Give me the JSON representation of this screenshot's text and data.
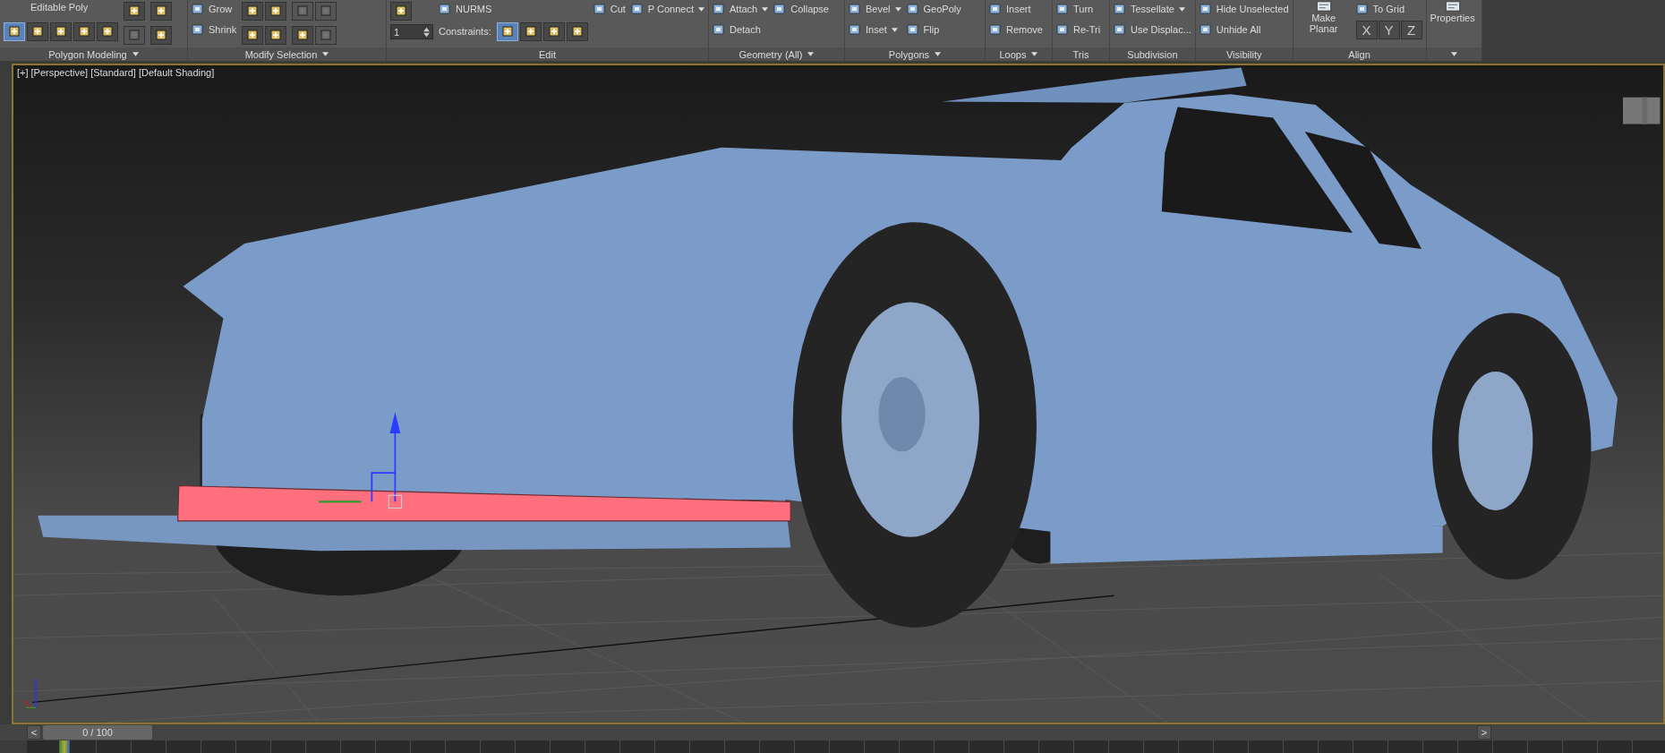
{
  "ribbon": {
    "panels": [
      {
        "title": "Polygon Modeling",
        "columns": [
          [
            {
              "kind": "label",
              "label": "Editable Poly"
            },
            {
              "kind": "icon-row",
              "buttons": [
                {
                  "selected": true,
                  "disabled": false
                },
                {
                  "selected": false,
                  "disabled": false
                },
                {
                  "selected": false,
                  "disabled": false
                },
                {
                  "selected": false,
                  "disabled": false
                },
                {
                  "selected": false,
                  "disabled": false
                }
              ]
            }
          ],
          [
            {
              "kind": "icon-row",
              "buttons": [
                {
                  "selected": false,
                  "disabled": false
                }
              ]
            },
            {
              "kind": "icon-row",
              "buttons": [
                {
                  "selected": false,
                  "disabled": true
                }
              ]
            }
          ],
          [
            {
              "kind": "icon-row",
              "buttons": [
                {
                  "selected": false,
                  "disabled": false
                }
              ]
            },
            {
              "kind": "icon-row",
              "buttons": [
                {
                  "selected": false,
                  "disabled": false
                }
              ]
            }
          ]
        ]
      },
      {
        "title": "Modify Selection",
        "columns": [
          [
            {
              "kind": "button",
              "label": "Grow",
              "dropdown": false
            },
            {
              "kind": "button",
              "label": "Shrink",
              "dropdown": false
            }
          ],
          [
            {
              "kind": "icon-row",
              "buttons": [
                {
                  "selected": false,
                  "disabled": false
                },
                {
                  "selected": false,
                  "disabled": false
                }
              ]
            },
            {
              "kind": "icon-row",
              "buttons": [
                {
                  "selected": false,
                  "disabled": false
                },
                {
                  "selected": false,
                  "disabled": false
                }
              ]
            }
          ],
          [
            {
              "kind": "icon-row",
              "buttons": [
                {
                  "selected": false,
                  "disabled": true
                },
                {
                  "selected": false,
                  "disabled": true
                }
              ]
            },
            {
              "kind": "icon-row",
              "buttons": [
                {
                  "selected": false,
                  "disabled": false
                },
                {
                  "selected": false,
                  "disabled": true
                }
              ]
            }
          ]
        ]
      },
      {
        "title": "Edit",
        "columns": [
          [
            {
              "kind": "icon-row",
              "buttons": [
                {
                  "selected": false,
                  "disabled": false
                }
              ]
            },
            {
              "kind": "spinner",
              "value": "1"
            }
          ],
          [
            {
              "kind": "button",
              "label": "NURMS",
              "dropdown": false
            },
            {
              "kind": "icon-row",
              "label": "Constraints:",
              "buttons": [
                {
                  "selected": true,
                  "disabled": false
                },
                {
                  "selected": false,
                  "disabled": false
                },
                {
                  "selected": false,
                  "disabled": false
                },
                {
                  "selected": false,
                  "disabled": false
                }
              ]
            }
          ],
          [
            {
              "kind": "button",
              "label": "Cut",
              "dropdown": false
            }
          ],
          [
            {
              "kind": "button",
              "label": "P Connect",
              "dropdown": true
            }
          ]
        ]
      },
      {
        "title": "Geometry (All)",
        "columns": [
          [
            {
              "kind": "button",
              "label": "Attach",
              "dropdown": true
            },
            {
              "kind": "button",
              "label": "Detach",
              "dropdown": false
            }
          ],
          [
            {
              "kind": "button",
              "label": "Collapse",
              "dropdown": false
            }
          ]
        ]
      },
      {
        "title": "Polygons",
        "columns": [
          [
            {
              "kind": "button",
              "label": "Bevel",
              "dropdown": true
            },
            {
              "kind": "button",
              "label": "Inset",
              "dropdown": true
            }
          ],
          [
            {
              "kind": "button",
              "label": "GeoPoly",
              "dropdown": false
            },
            {
              "kind": "button",
              "label": "Flip",
              "dropdown": false
            }
          ]
        ]
      },
      {
        "title": "Loops",
        "columns": [
          [
            {
              "kind": "button",
              "label": "Insert",
              "dropdown": false
            },
            {
              "kind": "button",
              "label": "Remove",
              "dropdown": false
            }
          ]
        ]
      },
      {
        "title": "Tris",
        "columns": [
          [
            {
              "kind": "button",
              "label": "Turn",
              "dropdown": false
            },
            {
              "kind": "button",
              "label": "Re-Tri",
              "dropdown": false
            }
          ]
        ]
      },
      {
        "title": "Subdivision",
        "columns": [
          [
            {
              "kind": "button",
              "label": "Tessellate",
              "dropdown": true
            },
            {
              "kind": "button",
              "label": "Use Displac...",
              "dropdown": false
            }
          ]
        ]
      },
      {
        "title": "Visibility",
        "columns": [
          [
            {
              "kind": "button",
              "label": "Hide Unselected",
              "dropdown": false
            },
            {
              "kind": "button",
              "label": "Unhide All",
              "dropdown": false
            }
          ]
        ]
      },
      {
        "title": "Align",
        "columns": [
          [
            {
              "kind": "large-button",
              "label": "Make Planar"
            }
          ],
          [
            {
              "kind": "button",
              "label": "To Grid",
              "dropdown": false
            },
            {
              "kind": "letter-row",
              "letters": [
                "X",
                "Y",
                "Z"
              ]
            }
          ]
        ]
      },
      {
        "columns": [
          [
            {
              "kind": "large-button",
              "label": "Properties"
            }
          ]
        ]
      }
    ]
  },
  "viewport": {
    "labels": [
      "[+]",
      "[Perspective]",
      "[Standard]",
      "[Default Shading]"
    ]
  },
  "timeline": {
    "prev": "<",
    "position": "0 / 100",
    "level": 0,
    "next": ">"
  }
}
